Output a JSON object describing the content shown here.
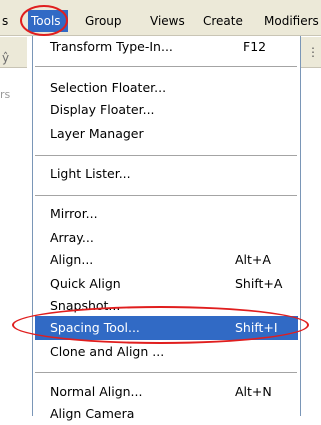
{
  "menubar": {
    "cut_label": "s",
    "items": [
      "Tools",
      "Group",
      "Views",
      "Create",
      "Modifiers"
    ]
  },
  "left": {
    "glyph": "ŷ",
    "fragment": "rs"
  },
  "right": {
    "dots": "⋮"
  },
  "menu": {
    "items": [
      {
        "label": "Transform Type-In...",
        "shortcut": "F12"
      },
      {
        "label": "Selection Floater...",
        "shortcut": ""
      },
      {
        "label": "Display Floater...",
        "shortcut": ""
      },
      {
        "label": "Layer Manager",
        "shortcut": ""
      },
      {
        "label": "Light Lister...",
        "shortcut": ""
      },
      {
        "label": "Mirror...",
        "shortcut": ""
      },
      {
        "label": "Array...",
        "shortcut": ""
      },
      {
        "label": "Align...",
        "shortcut": "Alt+A"
      },
      {
        "label": "Quick Align",
        "shortcut": "Shift+A"
      },
      {
        "label": "Snapshot...",
        "shortcut": ""
      },
      {
        "label": "Spacing Tool...",
        "shortcut": "Shift+I"
      },
      {
        "label": "Clone and Align ...",
        "shortcut": ""
      },
      {
        "label": "Normal Align...",
        "shortcut": "Alt+N"
      },
      {
        "label": "Align Camera",
        "shortcut": ""
      }
    ]
  },
  "colors": {
    "highlight": "#316ac5",
    "annotation": "#e01e1e",
    "menubar_bg": "#ece9d8"
  }
}
